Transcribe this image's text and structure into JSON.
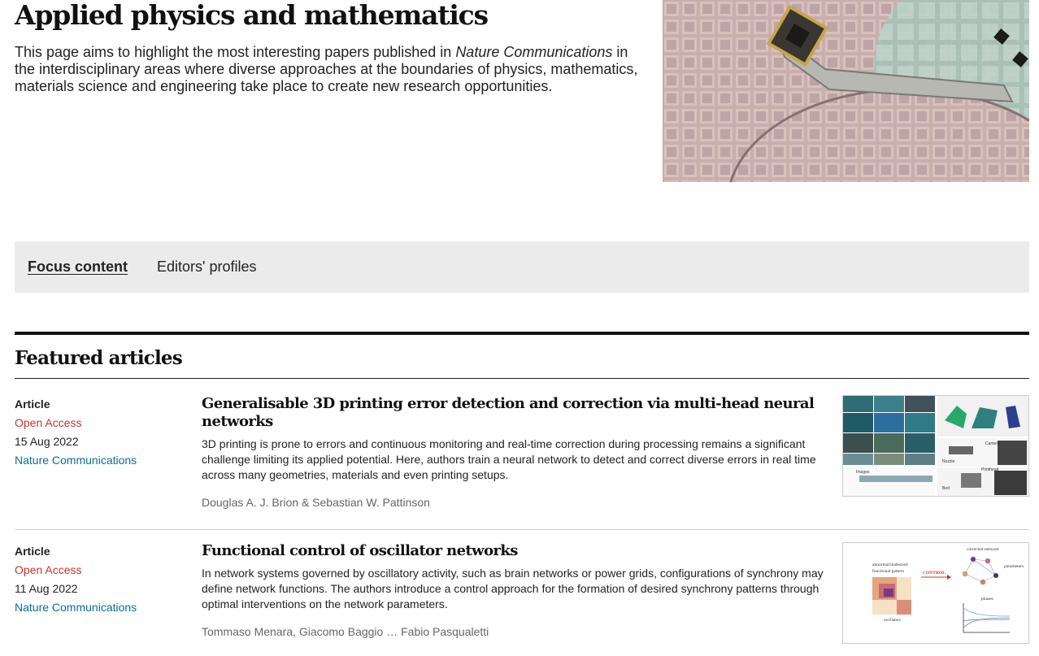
{
  "hero": {
    "title": "Applied physics and mathematics",
    "intro_before": "This page aims to highlight the most interesting papers published in ",
    "intro_journal": "Nature Communications",
    "intro_after": " in the interdisciplinary areas where diverse approaches at the boundaries of physics, mathematics, materials science and engineering take place to create new research opportunities."
  },
  "tabs": [
    {
      "label": "Focus content",
      "active": true
    },
    {
      "label": "Editors' profiles",
      "active": false
    }
  ],
  "featured": {
    "heading": "Featured articles",
    "articles": [
      {
        "type": "Article",
        "access": "Open Access",
        "date": "15 Aug 2022",
        "journal": "Nature Communications",
        "title": "Generalisable 3D printing error detection and correction via multi-head neural networks",
        "description": "3D printing is prone to errors and continuous monitoring and real-time correction during processing remains a significant challenge limiting its applied potential. Here, authors train a neural network to detect and correct diverse errors in real time across many geometries, materials and even printing setups.",
        "authors": "Douglas A. J. Brion & Sebastian W. Pattinson",
        "thumb_labels": [
          "Images",
          "Camera",
          "Printhead",
          "Nozzle",
          "Bed"
        ]
      },
      {
        "type": "Article",
        "access": "Open Access",
        "date": "11 Aug 2022",
        "journal": "Nature Communications",
        "title": "Functional control of oscillator networks",
        "description": "In network systems governed by oscillatory activity, such as brain networks or power grids, configurations of synchrony may define network functions. The authors introduce a control approach for the formation of desired synchrony patterns through optimal interventions on the network parameters.",
        "authors": "Tommaso Menara, Giacomo Baggio … Fabio Pasqualetti",
        "thumb_labels": [
          "abnormal/undesired",
          "functional pattern",
          "CONTROL",
          "corrected network",
          "parameters",
          "oscillators",
          "phases"
        ]
      }
    ]
  },
  "colors": {
    "open_access": "#c0392b",
    "journal_link": "#0b6e99",
    "tab_bar_bg": "#ebebeb"
  }
}
